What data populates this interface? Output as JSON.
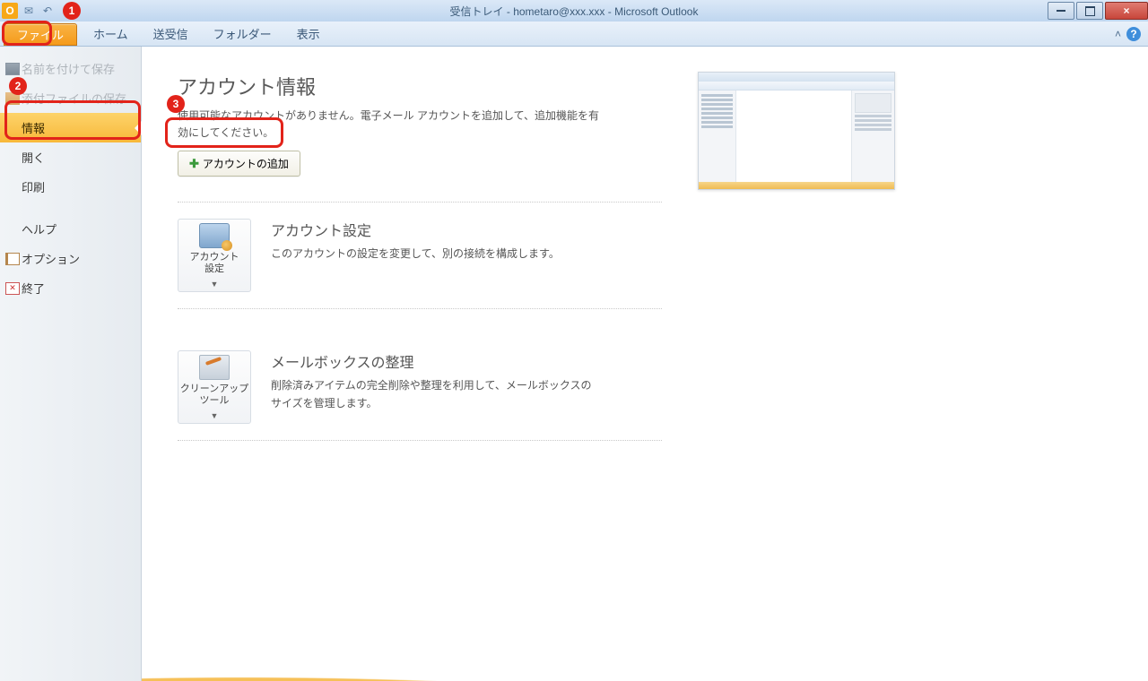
{
  "window": {
    "title": "受信トレイ - hometaro@xxx.xxx  -  Microsoft Outlook"
  },
  "ribbon": {
    "file": "ファイル",
    "home": "ホーム",
    "sendreceive": "送受信",
    "folder": "フォルダー",
    "view": "表示"
  },
  "nav": {
    "save_as": "名前を付けて保存",
    "save_attachments": "添付ファイルの保存",
    "info": "情報",
    "open": "開く",
    "print": "印刷",
    "help": "ヘルプ",
    "options": "オプション",
    "exit": "終了"
  },
  "info": {
    "heading": "アカウント情報",
    "subtext": "使用可能なアカウントがありません。電子メール アカウントを追加して、追加機能を有効にしてください。",
    "add_account": "アカウントの追加"
  },
  "account_settings": {
    "tile_label": "アカウント\n設定",
    "title": "アカウント設定",
    "desc": "このアカウントの設定を変更して、別の接続を構成します。"
  },
  "mailbox_cleanup": {
    "tile_label": "クリーンアップ\nツール",
    "title": "メールボックスの整理",
    "desc": "削除済みアイテムの完全削除や整理を利用して、メールボックスのサイズを管理します。"
  },
  "annotations": {
    "a1": "1",
    "a2": "2",
    "a3": "3"
  }
}
